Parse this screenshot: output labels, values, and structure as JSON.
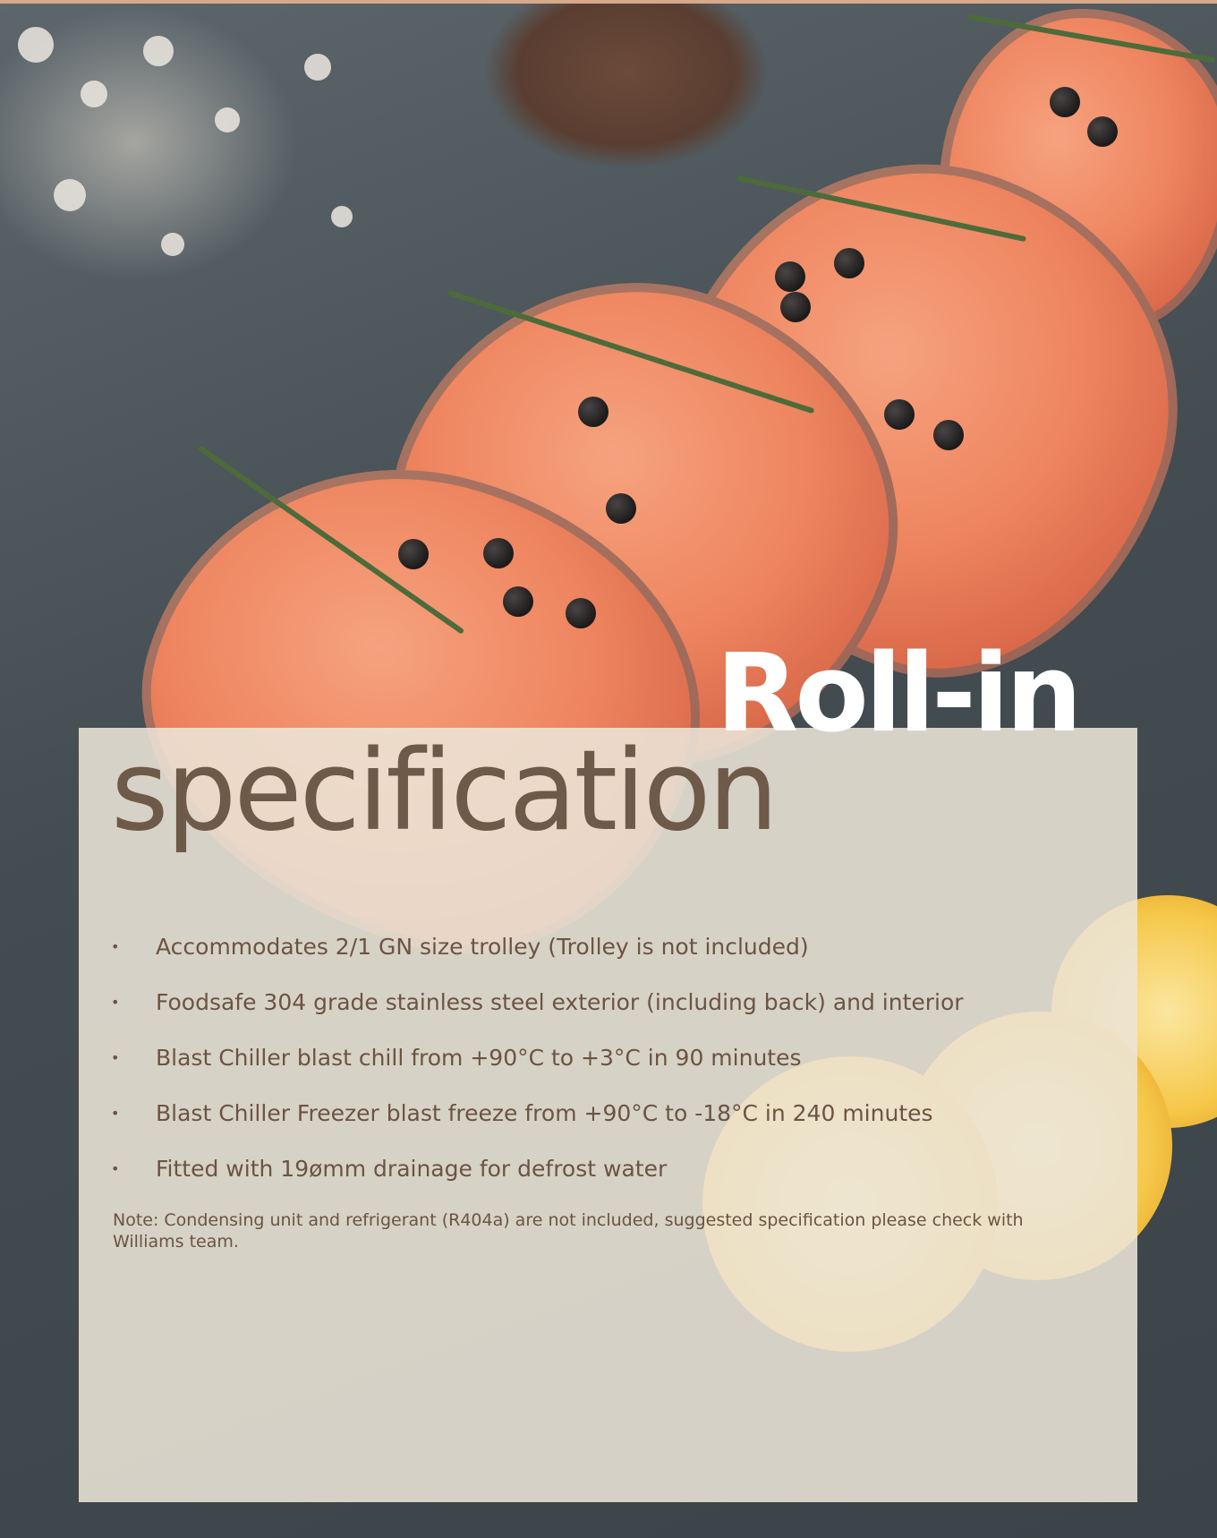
{
  "heading": {
    "line1": "Roll-in",
    "line2": "specification"
  },
  "bullets": [
    "Accommodates 2/1 GN size trolley (Trolley is not included)",
    "Foodsafe 304 grade stainless steel exterior (including back) and interior",
    "Blast Chiller blast chill from +90°C to +3°C in 90 minutes",
    "Blast Chiller Freezer blast freeze from +90°C to -18°C in 240 minutes",
    "Fitted with 19ømm drainage for defrost water"
  ],
  "bullet_marker": "•",
  "note": "Note: Condensing unit and refrigerant (R404a) are not included, suggested specification please check with Williams team.",
  "colors": {
    "heading_white": "#ffffff",
    "heading_brown": "#6e5a48",
    "body_text": "#6b5444",
    "panel": "#ece5d7",
    "top_strip": "#d6a98a"
  }
}
